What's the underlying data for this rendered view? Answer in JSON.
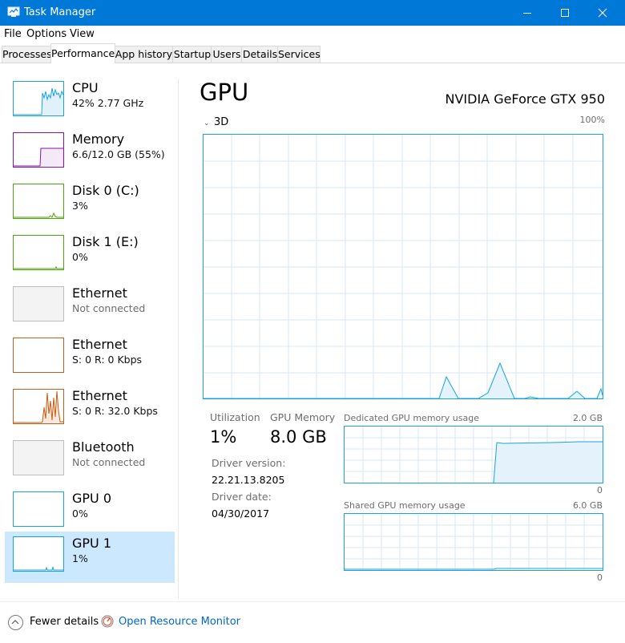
{
  "window": {
    "title": "Task Manager"
  },
  "menu": [
    "File",
    "Options",
    "View"
  ],
  "tabs": [
    "Processes",
    "Performance",
    "App history",
    "Startup",
    "Users",
    "Details",
    "Services"
  ],
  "active_tab": "Performance",
  "sidebar": {
    "items": [
      {
        "name": "CPU",
        "sub": "42%  2.77 GHz",
        "color": "#1ba1e2"
      },
      {
        "name": "Memory",
        "sub": "6.6/12.0 GB (55%)",
        "color": "#8b12ae"
      },
      {
        "name": "Disk 0 (C:)",
        "sub": "3%",
        "color": "#4da60c"
      },
      {
        "name": "Disk 1 (E:)",
        "sub": "0%",
        "color": "#4da60c"
      },
      {
        "name": "Ethernet",
        "sub": "Not connected",
        "color": "#a7a7a7"
      },
      {
        "name": "Ethernet",
        "sub": "S: 0  R: 0 Kbps",
        "color": "#c45d15"
      },
      {
        "name": "Ethernet",
        "sub": "S: 0  R: 32.0 Kbps",
        "color": "#c45d15"
      },
      {
        "name": "Bluetooth",
        "sub": "Not connected",
        "color": "#a7a7a7"
      },
      {
        "name": "GPU 0",
        "sub": "0%",
        "color": "#1ba1e2"
      },
      {
        "name": "GPU 1",
        "sub": "1%",
        "color": "#1ba1e2"
      }
    ],
    "selected": "GPU 1"
  },
  "main": {
    "title": "GPU",
    "device": "NVIDIA GeForce GTX 950",
    "engine": "3D",
    "max_label": "100%",
    "accent": "#1ba1e2",
    "stats": {
      "utilization_label": "Utilization",
      "utilization_value": "1%",
      "gpu_memory_label": "GPU Memory",
      "gpu_memory_value": "8.0 GB"
    },
    "driver_version_label": "Driver version:",
    "driver_version": "22.21.13.8205",
    "driver_date_label": "Driver date:",
    "driver_date": "04/30/2017",
    "dedicated": {
      "label": "Dedicated GPU memory usage",
      "max": "2.0 GB",
      "min": "0"
    },
    "shared": {
      "label": "Shared GPU memory usage",
      "max": "6.0 GB",
      "min": "0"
    }
  },
  "footer": {
    "fewer_details": "Fewer details",
    "resource_monitor": "Open Resource Monitor"
  }
}
